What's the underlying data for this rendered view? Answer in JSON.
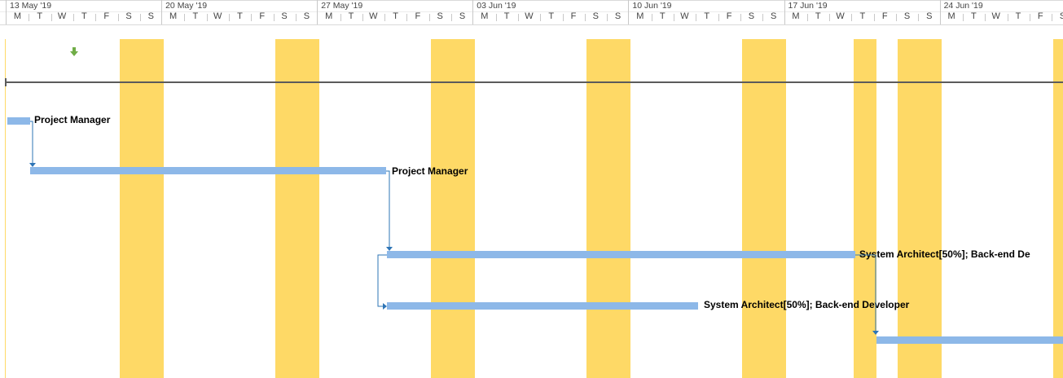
{
  "timescale": {
    "weeks": [
      "13 May '19",
      "20 May '19",
      "27 May '19",
      "03 Jun '19",
      "10 Jun '19",
      "17 Jun '19",
      "24 Jun '19"
    ],
    "day_letters": [
      "M",
      "T",
      "W",
      "T",
      "F",
      "S",
      "S"
    ]
  },
  "bars": {
    "task1_resource": "Project Manager",
    "task2_resource": "Project Manager",
    "task3_resource": "System Architect[50%]; Back-end De",
    "task4_resource": "System Architect[50%]; Back-end Developer"
  },
  "colors": {
    "nonworking": "#fed966",
    "bar": "#8db8e8",
    "link": "#2e75b6",
    "milestone_arrow": "#70ad47"
  },
  "icons": {
    "milestone": "down-arrow-icon"
  }
}
